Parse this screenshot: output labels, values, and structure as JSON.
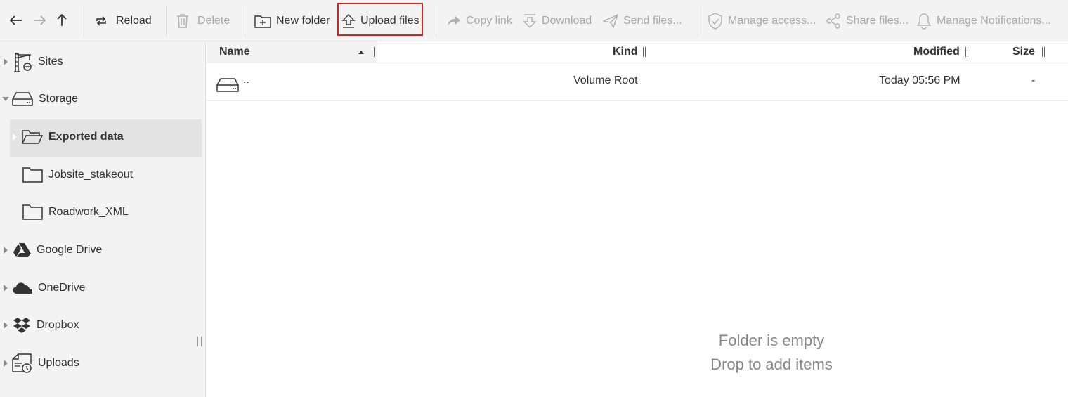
{
  "toolbar": {
    "reload": "Reload",
    "delete": "Delete",
    "new_folder": "New folder",
    "upload_files": "Upload files",
    "copy_link": "Copy link",
    "download": "Download",
    "send_files": "Send files...",
    "manage_access": "Manage access...",
    "share_files": "Share files...",
    "manage_notifications": "Manage Notifications..."
  },
  "sidebar": {
    "items": [
      {
        "label": "Sites",
        "icon": "crane-icon",
        "expanded": false
      },
      {
        "label": "Storage",
        "icon": "drive-icon",
        "expanded": true
      },
      {
        "label": "Exported data",
        "icon": "folder-open-icon",
        "selected": true
      },
      {
        "label": "Jobsite_stakeout",
        "icon": "folder-icon"
      },
      {
        "label": "Roadwork_XML",
        "icon": "folder-icon"
      },
      {
        "label": "Google Drive",
        "icon": "google-drive-icon",
        "expanded": false
      },
      {
        "label": "OneDrive",
        "icon": "onedrive-icon",
        "expanded": false
      },
      {
        "label": "Dropbox",
        "icon": "dropbox-icon",
        "expanded": false
      },
      {
        "label": "Uploads",
        "icon": "uploads-icon",
        "expanded": false
      }
    ]
  },
  "table": {
    "columns": {
      "name": "Name",
      "kind": "Kind",
      "modified": "Modified",
      "size": "Size"
    },
    "rows": [
      {
        "name": "..",
        "kind": "Volume Root",
        "modified": "Today 05:56 PM",
        "size": "-"
      }
    ]
  },
  "empty": {
    "line1": "Folder is empty",
    "line2": "Drop to add items"
  },
  "colors": {
    "highlight": "#d32222",
    "toolbar_bg": "#f3f3f3",
    "disabled_text": "#a8a8a8"
  }
}
